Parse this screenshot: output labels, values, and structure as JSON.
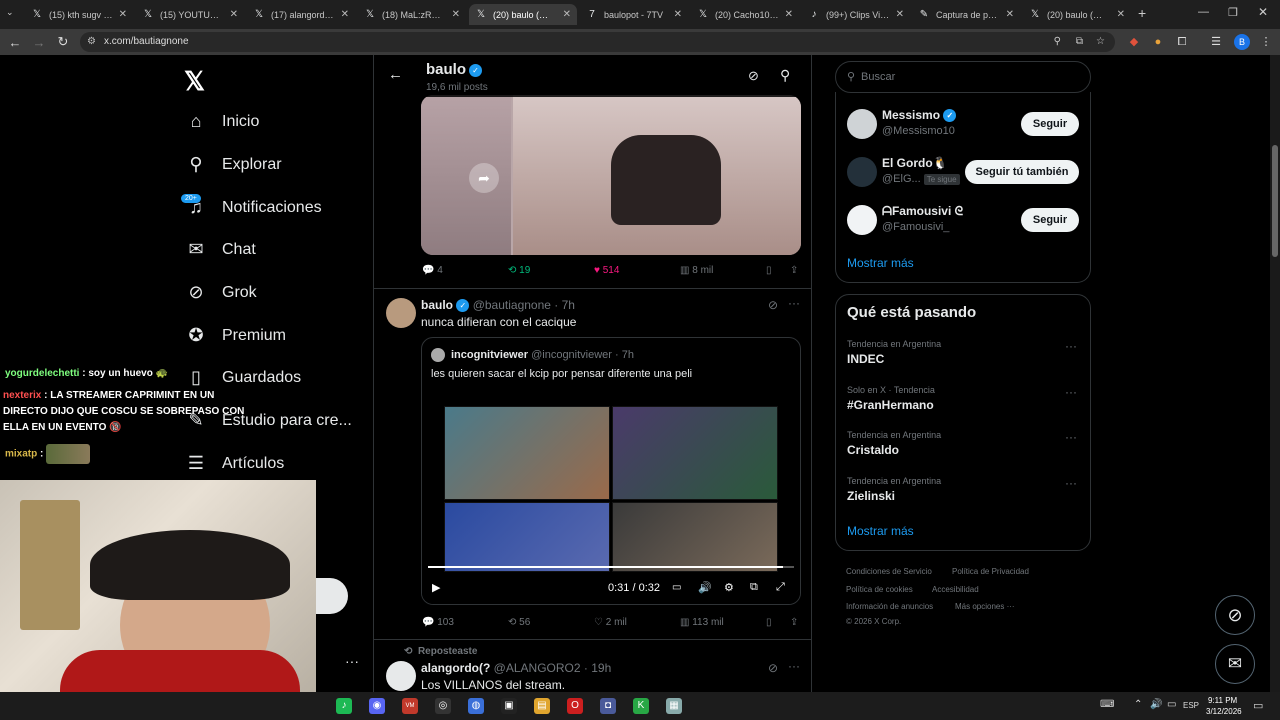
{
  "tabs": [
    {
      "label": "(15) kth sugv en X",
      "icon": "x-icon"
    },
    {
      "label": "(15) YOUTUBER C",
      "icon": "x-icon"
    },
    {
      "label": "(17) alangordo(?",
      "icon": "x-icon"
    },
    {
      "label": "(18) MaL:zRP en X",
      "icon": "x-icon"
    },
    {
      "label": "(20) baulo (@bau",
      "icon": "x-icon"
    },
    {
      "label": "baulopot - 7TV",
      "icon": "7tv-icon"
    },
    {
      "label": "(20) Cacho10 en X",
      "icon": "x-icon"
    },
    {
      "label": "(99+) Clips Virales",
      "icon": "tiktok-icon"
    },
    {
      "label": "Captura de panta",
      "icon": "pen-icon"
    },
    {
      "label": "(20) baulo (@bau",
      "icon": "x-icon"
    }
  ],
  "url": "x.com/bautiagnone",
  "sidebar": {
    "items": [
      {
        "label": "Inicio",
        "icon": "⌂"
      },
      {
        "label": "Explorar",
        "icon": "⚲"
      },
      {
        "label": "Notificaciones",
        "icon": "♫"
      },
      {
        "label": "Chat",
        "icon": "✉"
      },
      {
        "label": "Grok",
        "icon": "⊘"
      },
      {
        "label": "Premium",
        "icon": "✪"
      },
      {
        "label": "Guardados",
        "icon": "▯"
      },
      {
        "label": "Estudio para cre...",
        "icon": "✎"
      },
      {
        "label": "Artículos",
        "icon": "☰"
      }
    ],
    "notif_badge": "20+"
  },
  "profile_header": {
    "name": "baulo",
    "posts": "19,6 mil posts"
  },
  "post1_actions": {
    "replies": "4",
    "reposts": "19",
    "likes": "514",
    "views": "8 mil"
  },
  "post2": {
    "name": "baulo",
    "handle": "@bautiagnone",
    "time": "· 7h",
    "text": "nunca difieran con el cacique",
    "quote": {
      "name": "incognitviewer",
      "handle": "@incognitviewer",
      "time": "· 7h",
      "text": "les quieren sacar el kcip por pensar diferente una peli"
    },
    "video_time": "0:31 / 0:32",
    "video_progress": 0.97,
    "actions": {
      "replies": "103",
      "reposts": "56",
      "likes": "2 mil",
      "views": "113 mil"
    }
  },
  "post3": {
    "repost_label": "Reposteaste",
    "name": "alangordo(?",
    "handle": "@ALANGORO2",
    "time": "· 19h",
    "text": "Los VILLANOS del stream."
  },
  "search_placeholder": "Buscar",
  "who_to_follow": [
    {
      "name": "Messismo",
      "handle": "@Messismo10",
      "button": "Seguir",
      "verified": true,
      "tag": ""
    },
    {
      "name": "El Gordo🐧",
      "handle": "@ElG...",
      "button": "Seguir tú también",
      "verified": false,
      "tag": "Te sigue"
    },
    {
      "name": "ᗩFamousivi ᘓ",
      "handle": "@Famousivi_",
      "button": "Seguir",
      "verified": false,
      "tag": ""
    }
  ],
  "show_more": "Mostrar más",
  "trending_title": "Qué está pasando",
  "trends": [
    {
      "meta": "Tendencia en Argentina",
      "name": "INDEC"
    },
    {
      "meta": "Solo en X · Tendencia",
      "name": "#GranHermano"
    },
    {
      "meta": "Tendencia en Argentina",
      "name": "Cristaldo"
    },
    {
      "meta": "Tendencia en Argentina",
      "name": "Zielinski"
    }
  ],
  "show_more_2": "Mostrar más",
  "footer_links": [
    "Condiciones de Servicio",
    "Política de Privacidad",
    "Política de cookies",
    "Accesibilidad",
    "Información de anuncios",
    "Más opciones ···",
    "© 2026 X Corp."
  ],
  "chat": [
    {
      "user": "yogurdelechetti",
      "msg": "soy un huevo 🐢",
      "color": "#7fff7f"
    },
    {
      "user": "nexterix",
      "msg": "LA STREAMER CAPRIMINT EN UN DIRECTO DIJO QUE COSCU SE SOBREPASO CON ELLA EN UN EVENTO 🔞",
      "color": "#ff5050"
    },
    {
      "user": "mixatp",
      "msg": "",
      "color": "#d8b84a"
    }
  ],
  "taskbar": {
    "time": "9:11 PM",
    "date": "3/12/2026",
    "lang": "ESP"
  }
}
